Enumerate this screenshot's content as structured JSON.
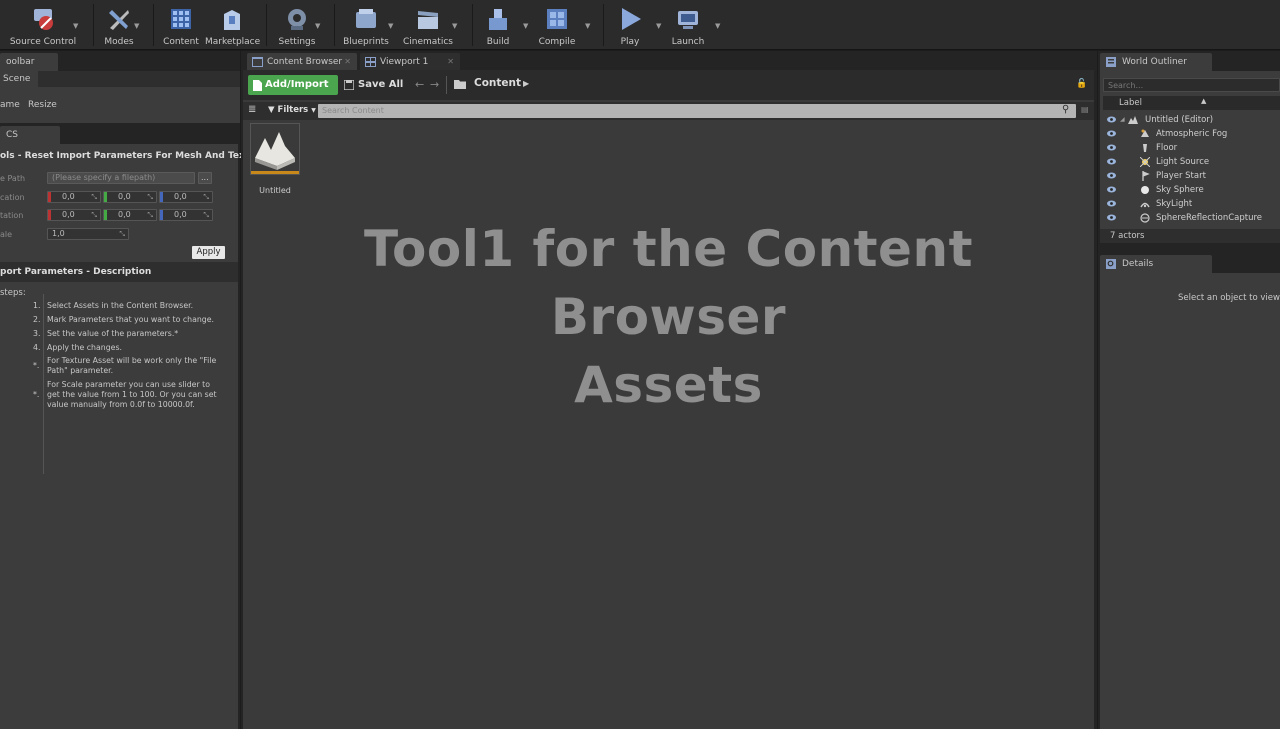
{
  "toolbar": {
    "items": [
      {
        "label": "Source Control",
        "icon": "source-control-icon"
      },
      {
        "label": "Modes",
        "icon": "modes-icon"
      },
      {
        "label": "Content",
        "icon": "content-icon"
      },
      {
        "label": "Marketplace",
        "icon": "marketplace-icon"
      },
      {
        "label": "Settings",
        "icon": "settings-icon"
      },
      {
        "label": "Blueprints",
        "icon": "blueprints-icon"
      },
      {
        "label": "Cinematics",
        "icon": "cinematics-icon"
      },
      {
        "label": "Build",
        "icon": "build-icon"
      },
      {
        "label": "Compile",
        "icon": "compile-icon"
      },
      {
        "label": "Play",
        "icon": "play-icon"
      },
      {
        "label": "Launch",
        "icon": "launch-icon"
      }
    ]
  },
  "left_panel": {
    "top_tab": "oolbar",
    "scene_tab": "Scene",
    "frame_label": "ame",
    "resize_label": "Resize",
    "second_tab": "CS",
    "tool_title": "ols - Reset Import Parameters For Mesh And Texture",
    "path_label": "e Path",
    "path_placeholder": "(Please specify a filepath)",
    "browse_label": "...",
    "location_label": "cation",
    "rotation_label": "tation",
    "scale_label": "ale",
    "location": [
      "0,0",
      "0,0",
      "0,0"
    ],
    "rotation": [
      "0,0",
      "0,0",
      "0,0"
    ],
    "scale": "1,0",
    "apply_label": "Apply",
    "desc_title": "port Parameters - Description",
    "steps_label": "steps:",
    "steps": [
      {
        "num": "1.",
        "text": "Select Assets in the Content Browser."
      },
      {
        "num": "2.",
        "text": "Mark Parameters that you want to change."
      },
      {
        "num": "3.",
        "text": "Set the value of the parameters.*"
      },
      {
        "num": "4.",
        "text": "Apply the changes."
      },
      {
        "num": "*.",
        "text": "For Texture Asset will be work only the \"File Path\" parameter."
      },
      {
        "num": "*.",
        "text": "For Scale parameter you can use slider to get the value from 1 to 100. Or you can set value manually from 0.0f to 10000.0f."
      }
    ]
  },
  "center": {
    "tabs": [
      {
        "label": "Content Browser"
      },
      {
        "label": "Viewport 1"
      }
    ],
    "add_import_label": "Add/Import",
    "save_all_label": "Save All",
    "path_root": "Content",
    "filters_label": "Filters",
    "search_placeholder": "Search Content",
    "asset_name": "Untitled",
    "overlay_line1": "Tool1 for the Content Browser",
    "overlay_line2": "Assets"
  },
  "outliner": {
    "tab": "World Outliner",
    "search_placeholder": "Search...",
    "column_label": "Label",
    "rows": [
      {
        "label": "Untitled (Editor)",
        "icon": "world-icon"
      },
      {
        "label": "Atmospheric Fog",
        "icon": "fog-icon"
      },
      {
        "label": "Floor",
        "icon": "mesh-icon"
      },
      {
        "label": "Light Source",
        "icon": "light-icon"
      },
      {
        "label": "Player Start",
        "icon": "player-start-icon"
      },
      {
        "label": "Sky Sphere",
        "icon": "sphere-icon"
      },
      {
        "label": "SkyLight",
        "icon": "skylight-icon"
      },
      {
        "label": "SphereReflectionCapture",
        "icon": "reflection-icon"
      }
    ],
    "actor_count": "7 actors"
  },
  "details": {
    "tab": "Details",
    "empty_message": "Select an object to view d"
  },
  "colors": {
    "accent_green": "#4aa54e",
    "panel": "#3c3c3c",
    "dark": "#242424",
    "overlay_text": "#8f8f8f"
  }
}
